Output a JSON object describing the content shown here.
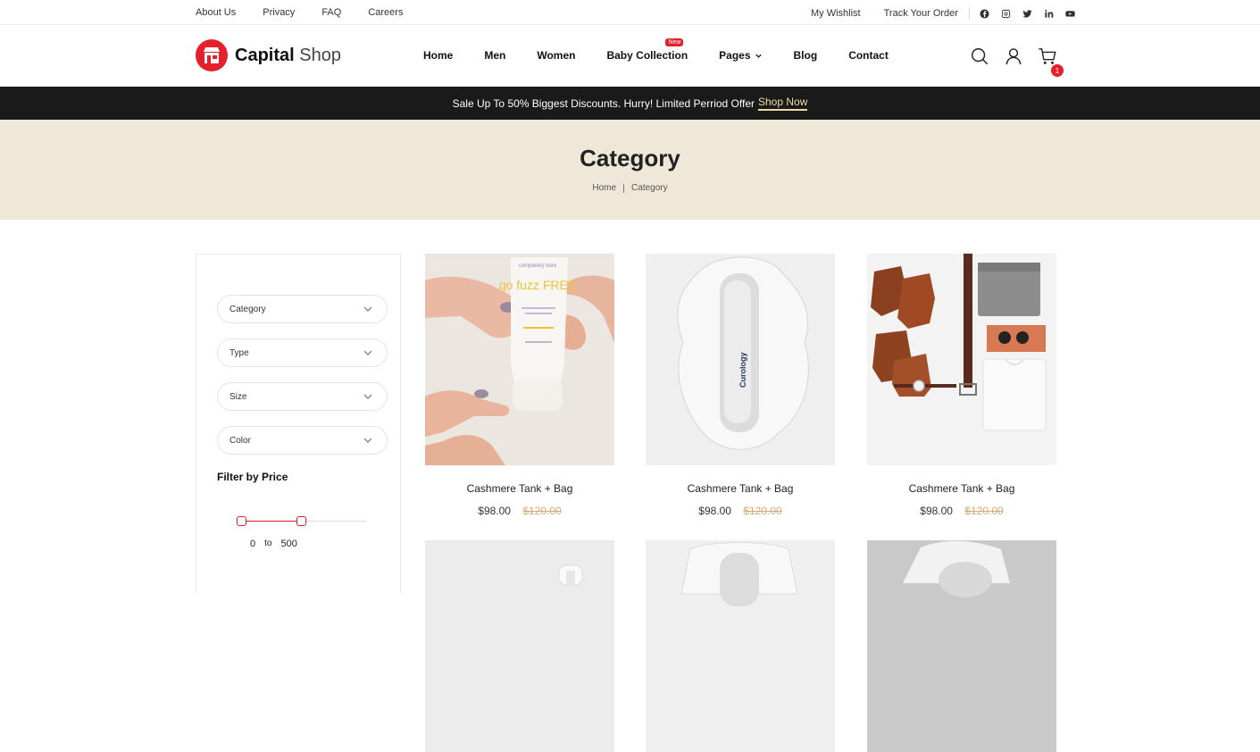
{
  "topbar": {
    "links": [
      "About Us",
      "Privacy",
      "FAQ",
      "Careers"
    ],
    "right_links": [
      "My Wishlist",
      "Track Your Order"
    ],
    "social_icons": [
      "facebook-icon",
      "instagram-icon",
      "twitter-icon",
      "linkedin-icon",
      "youtube-icon"
    ]
  },
  "header": {
    "logo_bold": "Capital",
    "logo_light": "Shop",
    "nav": [
      "Home",
      "Men",
      "Women",
      "Baby Collection",
      "Pages",
      "Blog",
      "Contact"
    ],
    "nav_badge": "New",
    "cart_count": "1",
    "accent": "#e5202a"
  },
  "promo": {
    "text": "Sale Up To 50% Biggest Discounts. Hurry! Limited Perriod Offer",
    "link": "Shop Now"
  },
  "banner": {
    "title": "Category",
    "breadcrumb": [
      "Home",
      "Category"
    ],
    "bg": "#efe8d8"
  },
  "sidebar": {
    "filters": [
      "Category",
      "Type",
      "Size",
      "Color"
    ],
    "price_title": "Filter by Price",
    "price_min": "0",
    "price_to": "to",
    "price_max": "500"
  },
  "products": [
    {
      "name": "Cashmere Tank + Bag",
      "price": "$98.00",
      "old_price": "$120.00"
    },
    {
      "name": "Cashmere Tank + Bag",
      "price": "$98.00",
      "old_price": "$120.00"
    },
    {
      "name": "Cashmere Tank + Bag",
      "price": "$98.00",
      "old_price": "$120.00"
    }
  ],
  "product_images": {
    "p1_tube_brand": "completely bare",
    "p1_tube_title": "go fuzz FREE",
    "p2_bottle_brand": "Curology"
  }
}
